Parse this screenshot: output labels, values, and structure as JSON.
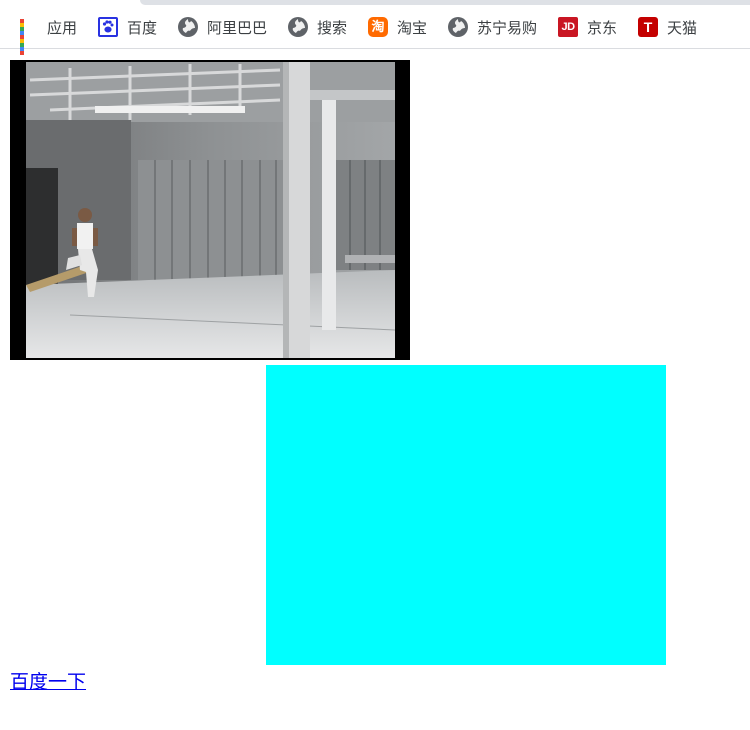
{
  "bookmarks": {
    "apps": {
      "label": "应用",
      "icon": "apps-grid-icon"
    },
    "baidu": {
      "label": "百度",
      "icon": "baidu-paw-icon"
    },
    "alibaba": {
      "label": "阿里巴巴",
      "icon": "globe-icon"
    },
    "search": {
      "label": "搜索",
      "icon": "globe-icon"
    },
    "taobao": {
      "label": "淘宝",
      "icon": "taobao-icon",
      "icon_text": "淘"
    },
    "suning": {
      "label": "苏宁易购",
      "icon": "globe-icon"
    },
    "jd": {
      "label": "京东",
      "icon": "jd-icon",
      "icon_text": "JD"
    },
    "tmall": {
      "label": "天猫",
      "icon": "tmall-icon",
      "icon_text": "T"
    }
  },
  "video": {
    "description_icon": "video-player"
  },
  "box": {
    "color": "#00ffff"
  },
  "link": {
    "label": "百度一下",
    "color": "#0000ee"
  }
}
